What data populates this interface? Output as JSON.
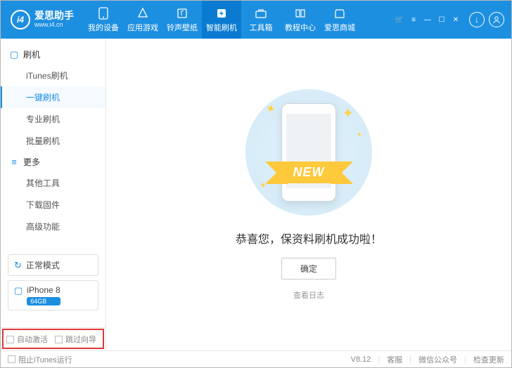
{
  "brand": {
    "logo_text": "i4",
    "title": "爱思助手",
    "subtitle": "www.i4.cn"
  },
  "top_tabs": [
    {
      "label": "我的设备",
      "icon": "phone"
    },
    {
      "label": "应用游戏",
      "icon": "apps"
    },
    {
      "label": "铃声壁纸",
      "icon": "music"
    },
    {
      "label": "智能刷机",
      "icon": "flash",
      "active": true
    },
    {
      "label": "工具箱",
      "icon": "toolbox"
    },
    {
      "label": "教程中心",
      "icon": "book"
    },
    {
      "label": "爱思商城",
      "icon": "shop"
    }
  ],
  "sidebar": {
    "groups": [
      {
        "icon": "☐",
        "title": "刷机",
        "items": [
          "iTunes刷机",
          "一键刷机",
          "专业刷机",
          "批量刷机"
        ],
        "active_index": 1
      },
      {
        "icon": "≡",
        "title": "更多",
        "items": [
          "其他工具",
          "下载固件",
          "高级功能"
        ],
        "active_index": -1
      }
    ],
    "mode_box": {
      "icon": "↻",
      "label": "正常模式"
    },
    "device_box": {
      "icon": "☐",
      "name": "iPhone 8",
      "badge": "64GB"
    },
    "checks": [
      {
        "label": "自动激活",
        "checked": false
      },
      {
        "label": "跳过向导",
        "checked": false
      }
    ]
  },
  "main": {
    "ribbon": "NEW",
    "message": "恭喜您，保资料刷机成功啦！",
    "ok_button": "确定",
    "log_link": "查看日志"
  },
  "footer": {
    "block_itunes": "阻止iTunes运行",
    "version": "V8.12",
    "links": [
      "客服",
      "微信公众号",
      "检查更新"
    ]
  }
}
